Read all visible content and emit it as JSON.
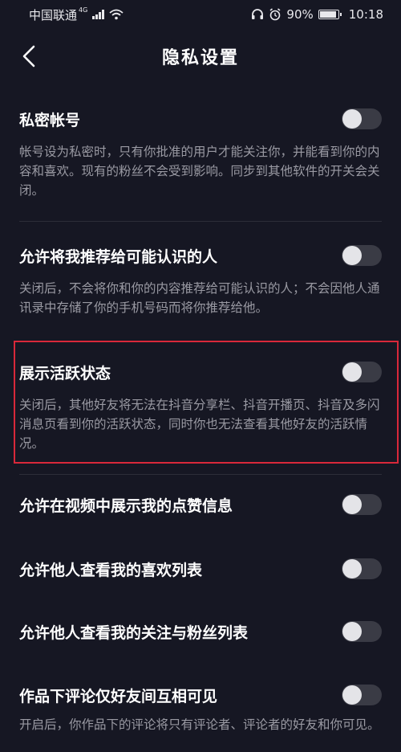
{
  "status_bar": {
    "carrier": "中国联通",
    "network": "4G",
    "battery": "90%",
    "battery_level": 0.9,
    "time": "10:18"
  },
  "header": {
    "title": "隐私设置",
    "back_icon": "chevron-left-icon"
  },
  "settings": [
    {
      "title": "私密帐号",
      "description": "帐号设为私密时，只有你批准的用户才能关注你，并能看到你的内容和喜欢。现有的粉丝不会受到影响。同步到其他软件的开关会关闭。",
      "enabled": false
    },
    {
      "title": "允许将我推荐给可能认识的人",
      "description": "关闭后，不会将你和你的内容推荐给可能认识的人；不会因他人通讯录中存储了你的手机号码而将你推荐给他。",
      "enabled": false
    },
    {
      "title": "展示活跃状态",
      "description": "关闭后，其他好友将无法在抖音分享栏、抖音开播页、抖音及多闪消息页看到你的活跃状态，同时你也无法查看其他好友的活跃情况。",
      "enabled": false
    },
    {
      "title": "允许在视频中展示我的点赞信息",
      "enabled": false
    },
    {
      "title": "允许他人查看我的喜欢列表",
      "enabled": false
    },
    {
      "title": "允许他人查看我的关注与粉丝列表",
      "enabled": false
    },
    {
      "title": "作品下评论仅好友间互相可见",
      "description": "开启后，你作品下的评论将只有评论者、评论者的好友和你可见。",
      "enabled": false
    }
  ],
  "colors": {
    "background": "#161723",
    "highlight": "#d9283a",
    "description_text": "#9a9aa3",
    "toggle_off": "#3a3b45"
  }
}
